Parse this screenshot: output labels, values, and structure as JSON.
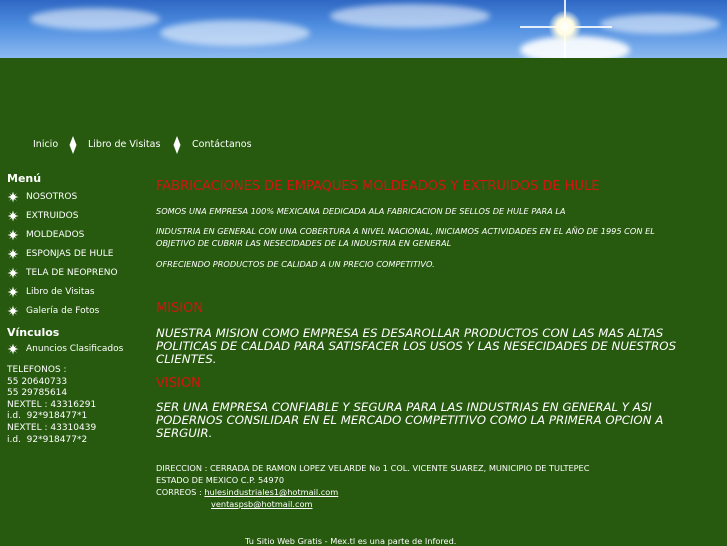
{
  "colors": {
    "background": "#275a0f",
    "title_red": "#d4150f",
    "text": "#ffffff"
  },
  "topnav": {
    "items": [
      {
        "label": "Inicio"
      },
      {
        "label": "Libro de Visitas"
      },
      {
        "label": "Contáctanos"
      }
    ]
  },
  "sidebar": {
    "menu_heading": "Menú",
    "menu_items": [
      {
        "label": "NOSOTROS"
      },
      {
        "label": "EXTRUIDOS"
      },
      {
        "label": "MOLDEADOS"
      },
      {
        "label": "ESPONJAS DE HULE"
      },
      {
        "label": "TELA DE NEOPRENO"
      },
      {
        "label": "Libro de Visitas"
      },
      {
        "label": "Galería de Fotos"
      }
    ],
    "links_heading": "Vínculos",
    "links_items": [
      {
        "label": "Anuncios Clasificados"
      }
    ],
    "contact": {
      "line1": "TELEFONOS :",
      "line2": "55 20640733",
      "line3": "55 29785614",
      "line4": "NEXTEL : 43316291",
      "line5": "i.d.  92*918477*1",
      "line6": "NEXTEL : 43310439",
      "line7": "i.d.  92*918477*2"
    }
  },
  "main": {
    "title": "FABRICACIONES DE EMPAQUES MOLDEADOS Y EXTRUIDOS DE HULE",
    "para1": "SOMOS UNA EMPRESA 100% MEXICANA DEDICADA ALA FABRICACION DE SELLOS DE HULE PARA LA",
    "para2": "INDUSTRIA EN GENERAL CON UNA COBERTURA A NIVEL NACIONAL, INICIAMOS ACTIVIDADES EN EL AÑO DE 1995 CON EL OBJETIVO DE CUBRIR LAS NESECIDADES DE LA INDUSTRIA EN GENERAL",
    "para3": "OFRECIENDO PRODUCTOS DE CALIDAD A UN PRECIO COMPETITIVO.",
    "mision_title": "MISION",
    "mision_text": "NUESTRA MISION COMO EMPRESA ES  DESAROLLAR PRODUCTOS CON LAS MAS ALTAS POLITICAS DE CALDAD PARA SATISFACER LOS USOS Y LAS NESECIDADES DE NUESTROS CLIENTES.",
    "vision_title": "VISION",
    "vision_text": " SER UNA EMPRESA  CONFIABLE Y SEGURA PARA LAS INDUSTRIAS EN GENERAL Y ASI PODERNOS CONSILIDAR EN EL MERCADO COMPETITIVO COMO LA PRIMERA OPCION A SERGUIR.",
    "address_line1": "DIRECCION : CERRADA DE RAMON LOPEZ VELARDE No 1 COL. VICENTE SUAREZ, MUNICIPIO DE TULTEPEC",
    "address_line2": "ESTADO DE MEXICO C.P. 54970",
    "correos_label": "CORREOS : ",
    "email1": "hulesindustriales1@hotmail.com",
    "email2": "ventaspsb@hotmail.com"
  },
  "footer": {
    "text": "Tu Sitio Web Gratis - Mex.tl es una parte de Infored."
  }
}
